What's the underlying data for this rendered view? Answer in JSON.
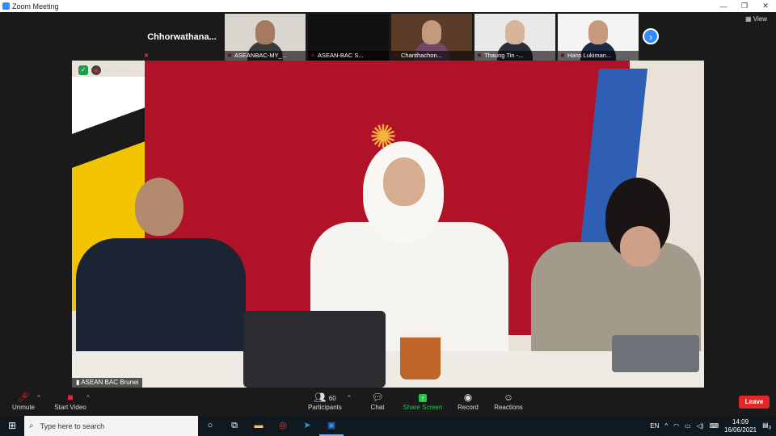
{
  "window": {
    "title": "Zoom Meeting",
    "minimize": "—",
    "restore": "❐",
    "close": "✕"
  },
  "gallery": {
    "self_name": "Chhorwathana...",
    "tiles": [
      {
        "name": "ASEANBAC-MY_..."
      },
      {
        "name": "ASEAN-BAC S..."
      },
      {
        "name": "Chanthachon..."
      },
      {
        "name": "Thaung Tin -..."
      },
      {
        "name": "Hans Lukiman..."
      }
    ],
    "next_icon": "›",
    "view_label": "View"
  },
  "main_video": {
    "recording_label": "Recording...",
    "speaker_name": "ASEAN BAC Brunei",
    "emblem_icon": "✺"
  },
  "toolbar": {
    "unmute_label": "Unmute",
    "start_video_label": "Start Video",
    "participants_label": "Participants",
    "participants_count": "60",
    "chat_label": "Chat",
    "share_label": "Share Screen",
    "record_label": "Record",
    "reactions_label": "Reactions",
    "leave_label": "Leave"
  },
  "taskbar": {
    "search_placeholder": "Type here to search",
    "language": "EN",
    "time": "14:09",
    "date": "16/06/2021",
    "notification_count": "3"
  }
}
